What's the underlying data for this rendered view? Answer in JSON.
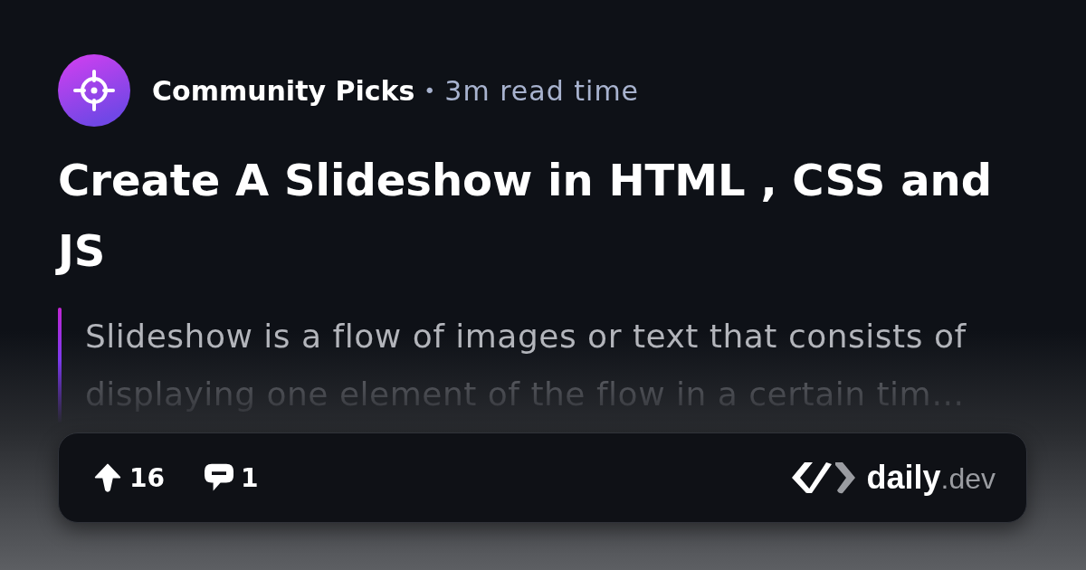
{
  "source": {
    "name": "Community Picks",
    "separator": "•",
    "read_time": "3m read time"
  },
  "title": "Create A Slideshow in HTML , CSS and JS",
  "summary": "Slideshow is a flow of images or text that consists of displaying one element of the flow in a certain tim…",
  "stats": [
    {
      "kind": "upvotes",
      "count": "16"
    },
    {
      "kind": "comments",
      "count": "1"
    }
  ],
  "brand": {
    "wordmark": "**daily**.dev"
  }
}
